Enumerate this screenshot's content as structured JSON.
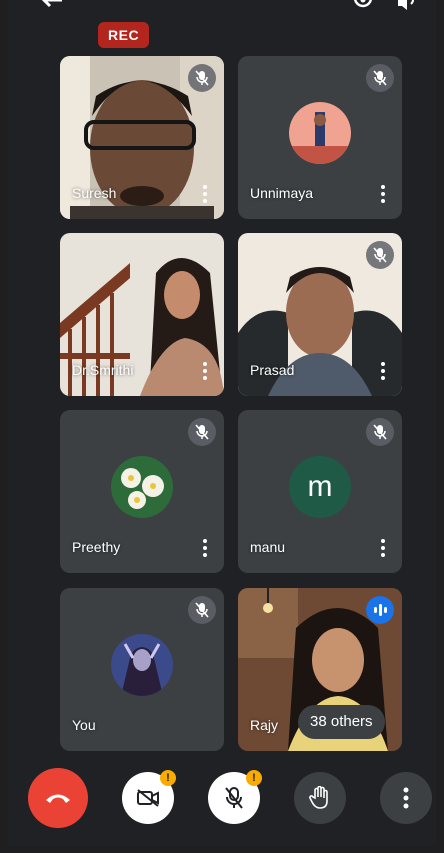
{
  "recording": {
    "label": "REC"
  },
  "participants": [
    {
      "name": "Suresh",
      "muted": true,
      "kind": "video"
    },
    {
      "name": "Unnimaya",
      "muted": true,
      "kind": "avatar"
    },
    {
      "name": "Dr.Smrithi",
      "muted": false,
      "kind": "video"
    },
    {
      "name": "Prasad",
      "muted": true,
      "kind": "video"
    },
    {
      "name": "Preethy",
      "muted": true,
      "kind": "avatar"
    },
    {
      "name": "manu",
      "muted": true,
      "kind": "letter",
      "initial": "m"
    },
    {
      "name": "You",
      "muted": true,
      "kind": "avatar"
    },
    {
      "name": "Rajy",
      "muted": false,
      "kind": "video",
      "speaking": true
    }
  ],
  "others_chip": {
    "label": "38 others"
  },
  "controls": {
    "camera_badge": "!",
    "mic_badge": "!"
  },
  "colors": {
    "end_call": "#ea4335",
    "rec": "#b3261e",
    "tile": "#3c4043",
    "speaking": "#1a73e8",
    "manu_avatar": "#1f5a46"
  }
}
